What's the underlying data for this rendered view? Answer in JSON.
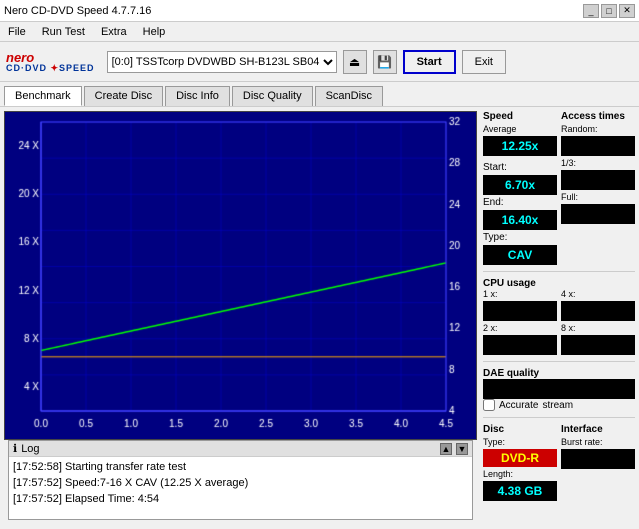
{
  "titlebar": {
    "title": "Nero CD-DVD Speed 4.7.7.16",
    "controls": [
      "_",
      "□",
      "✕"
    ]
  },
  "menu": {
    "items": [
      "File",
      "Run Test",
      "Extra",
      "Help"
    ]
  },
  "toolbar": {
    "drive": "[0:0]  TSSTcorp DVDWBD SH-B123L SB04",
    "start_label": "Start",
    "exit_label": "Exit"
  },
  "tabs": [
    {
      "label": "Benchmark",
      "active": true
    },
    {
      "label": "Create Disc",
      "active": false
    },
    {
      "label": "Disc Info",
      "active": false
    },
    {
      "label": "Disc Quality",
      "active": false
    },
    {
      "label": "ScanDisc",
      "active": false
    }
  ],
  "chart": {
    "title": "",
    "x_labels": [
      "0.0",
      "0.5",
      "1.0",
      "1.5",
      "2.0",
      "2.5",
      "3.0",
      "3.5",
      "4.0",
      "4.5"
    ],
    "y_left_labels": [
      "4 X",
      "8 X",
      "12 X",
      "16 X",
      "20 X",
      "24 X"
    ],
    "y_right_labels": [
      "4",
      "8",
      "12",
      "16",
      "20",
      "24",
      "28",
      "32"
    ]
  },
  "stats": {
    "speed": {
      "title": "Speed",
      "average_label": "Average",
      "average_value": "12.25x",
      "start_label": "Start:",
      "start_value": "6.70x",
      "end_label": "End:",
      "end_value": "16.40x",
      "type_label": "Type:",
      "type_value": "CAV"
    },
    "access_times": {
      "title": "Access times",
      "random_label": "Random:",
      "random_value": "",
      "onethird_label": "1/3:",
      "onethird_value": "",
      "full_label": "Full:",
      "full_value": ""
    },
    "cpu": {
      "title": "CPU usage",
      "x1_label": "1 x:",
      "x1_value": "",
      "x2_label": "2 x:",
      "x2_value": "",
      "x4_label": "4 x:",
      "x4_value": "",
      "x8_label": "8 x:",
      "x8_value": ""
    },
    "dae": {
      "title": "DAE quality",
      "value": "",
      "accurate_label": "Accurate",
      "stream_label": "stream"
    },
    "disc": {
      "title": "Disc",
      "type_label": "Type:",
      "type_value": "DVD-R",
      "length_label": "Length:",
      "length_value": "4.38 GB"
    },
    "interface": {
      "title": "Interface",
      "burst_label": "Burst rate:",
      "burst_value": ""
    }
  },
  "log": {
    "entries": [
      "[17:52:58]  Starting transfer rate test",
      "[17:57:52]  Speed:7-16 X CAV (12.25 X average)",
      "[17:57:52]  Elapsed Time: 4:54"
    ]
  }
}
